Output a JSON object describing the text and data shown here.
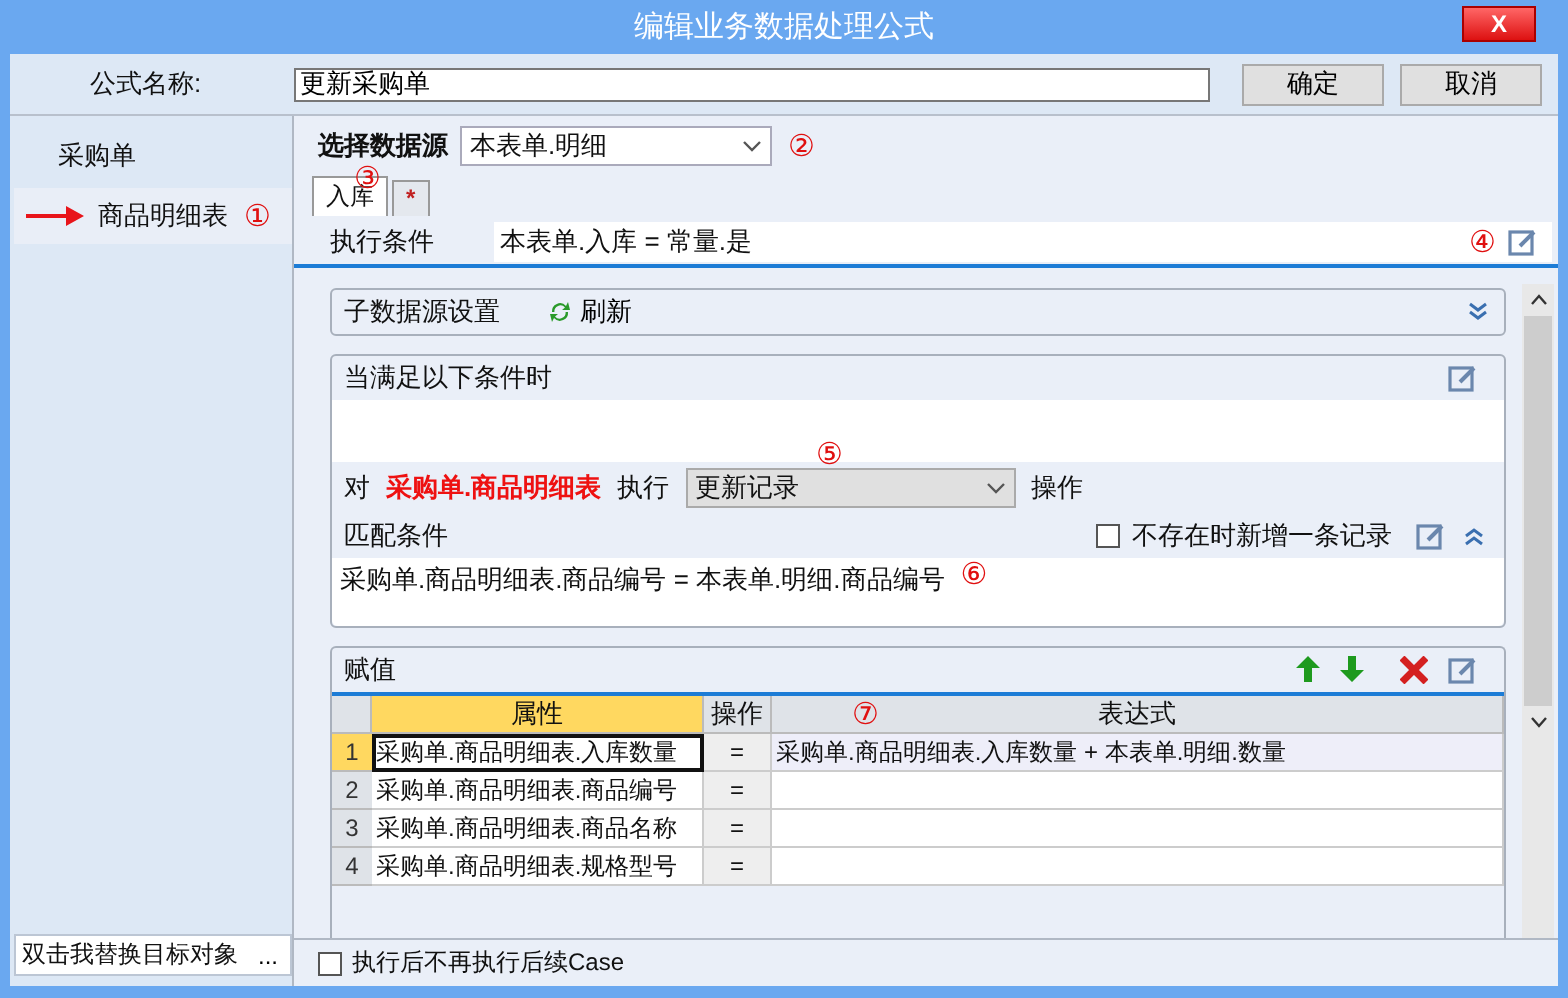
{
  "window": {
    "title": "编辑业务数据处理公式",
    "close": "X"
  },
  "formula_name": {
    "label": "公式名称:",
    "value": "更新采购单"
  },
  "buttons": [
    "确定",
    "取消"
  ],
  "sidebar": {
    "items": [
      {
        "label": "采购单",
        "selected": false
      },
      {
        "label": "商品明细表",
        "selected": true,
        "marker": "①"
      }
    ],
    "replace_field": {
      "value": "双击我替换目标对象",
      "button": "..."
    }
  },
  "data_source": {
    "label": "选择数据源",
    "value": "本表单.明细",
    "marker": "②"
  },
  "tabs": [
    {
      "label": "入库",
      "selected": true
    },
    {
      "label": "*",
      "selected": false
    }
  ],
  "tabs_marker": "③",
  "condition": {
    "label": "执行条件",
    "value": "本表单.入库 = 常量.是",
    "marker": "④"
  },
  "sub_source": {
    "label": "子数据源设置",
    "refresh": "刷新"
  },
  "rule": {
    "label": "当满足以下条件时",
    "prefix": "对",
    "target": "采购单.商品明细表",
    "verb": "执行",
    "operation": "更新记录",
    "suffix": "操作",
    "marker": "⑤",
    "match_label": "匹配条件",
    "add_if_missing": {
      "label": "不存在时新增一条记录",
      "checked": false
    },
    "match_expression": "采购单.商品明细表.商品编号 = 本表单.明细.商品编号",
    "match_marker": "⑥"
  },
  "assign": {
    "label": "赋值",
    "columns": [
      "属性",
      "操作",
      "表达式"
    ],
    "marker": "⑦",
    "rows": [
      {
        "index": "1",
        "property": "采购单.商品明细表.入库数量",
        "op": "=",
        "expression": "采购单.商品明细表.入库数量 + 本表单.明细.数量",
        "selected": true
      },
      {
        "index": "2",
        "property": "采购单.商品明细表.商品编号",
        "op": "=",
        "expression": "",
        "selected": false
      },
      {
        "index": "3",
        "property": "采购单.商品明细表.商品名称",
        "op": "=",
        "expression": "",
        "selected": false
      },
      {
        "index": "4",
        "property": "采购单.商品明细表.规格型号",
        "op": "=",
        "expression": "",
        "selected": false
      }
    ]
  },
  "stop_after": {
    "label": "执行后不再执行后续Case",
    "checked": false
  }
}
